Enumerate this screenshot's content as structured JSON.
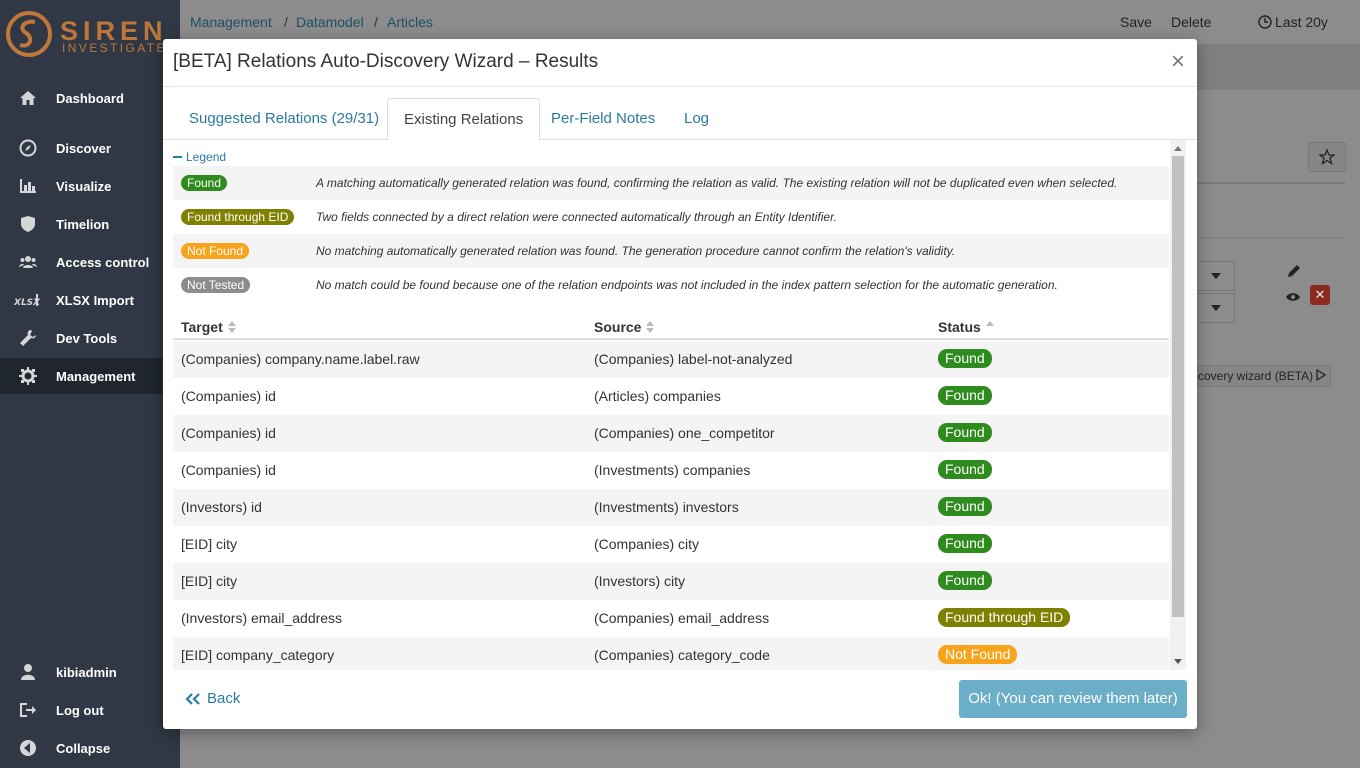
{
  "brand": {
    "name": "SIREN",
    "sub": "INVESTIGATE"
  },
  "sidebar": {
    "items": [
      {
        "label": "Dashboard",
        "icon": "home-icon"
      },
      {
        "label": "Discover",
        "icon": "compass-icon"
      },
      {
        "label": "Visualize",
        "icon": "bar-chart-icon"
      },
      {
        "label": "Timelion",
        "icon": "shield-icon"
      },
      {
        "label": "Access control",
        "icon": "users-icon"
      },
      {
        "label": "XLSX Import",
        "icon": "xlsx-icon"
      },
      {
        "label": "Dev Tools",
        "icon": "wrench-icon"
      },
      {
        "label": "Management",
        "icon": "gear-icon"
      }
    ],
    "bottom": [
      {
        "label": "kibiadmin",
        "icon": "user-icon"
      },
      {
        "label": "Log out",
        "icon": "logout-icon"
      },
      {
        "label": "Collapse",
        "icon": "collapse-icon"
      }
    ]
  },
  "breadcrumb": {
    "items": [
      "Management",
      "Datamodel",
      "Articles"
    ],
    "sep": "/"
  },
  "top_actions": {
    "save": "Save",
    "delete": "Delete",
    "time": "Last 20y"
  },
  "background": {
    "wizard_btn": "covery wizard (BETA)"
  },
  "modal": {
    "title": "[BETA] Relations Auto-Discovery Wizard – Results",
    "close": "×",
    "tabs": [
      "Suggested Relations (29/31)",
      "Existing Relations",
      "Per-Field Notes",
      "Log"
    ],
    "active_tab": "Existing Relations",
    "legend_toggle": "Legend",
    "legend": [
      {
        "badge": "Found",
        "color": "#2e8b1e",
        "desc": "A matching automatically generated relation was found, confirming the relation as valid. The existing relation will not be duplicated even when selected."
      },
      {
        "badge": "Found through EID",
        "color": "#7f7f00",
        "desc": "Two fields connected by a direct relation were connected automatically through an Entity Identifier."
      },
      {
        "badge": "Not Found",
        "color": "#f5a41c",
        "desc": "No matching automatically generated relation was found. The generation procedure cannot confirm the relation's validity."
      },
      {
        "badge": "Not Tested",
        "color": "#8c8c8c",
        "desc": "No match could be found because one of the relation endpoints was not included in the index pattern selection for the automatic generation."
      }
    ],
    "columns": {
      "target": "Target",
      "source": "Source",
      "status": "Status"
    },
    "rows": [
      {
        "target": "(Companies) company.name.label.raw",
        "source": "(Companies) label-not-analyzed",
        "status": "Found",
        "color": "#2e8b1e"
      },
      {
        "target": "(Companies) id",
        "source": "(Articles) companies",
        "status": "Found",
        "color": "#2e8b1e"
      },
      {
        "target": "(Companies) id",
        "source": "(Companies) one_competitor",
        "status": "Found",
        "color": "#2e8b1e"
      },
      {
        "target": "(Companies) id",
        "source": "(Investments) companies",
        "status": "Found",
        "color": "#2e8b1e"
      },
      {
        "target": "(Investors) id",
        "source": "(Investments) investors",
        "status": "Found",
        "color": "#2e8b1e"
      },
      {
        "target": "[EID] city",
        "source": "(Companies) city",
        "status": "Found",
        "color": "#2e8b1e"
      },
      {
        "target": "[EID] city",
        "source": "(Investors) city",
        "status": "Found",
        "color": "#2e8b1e"
      },
      {
        "target": "(Investors) email_address",
        "source": "(Companies) email_address",
        "status": "Found through EID",
        "color": "#7f7f00"
      },
      {
        "target": "[EID] company_category",
        "source": "(Companies) category_code",
        "status": "Not Found",
        "color": "#f5a41c"
      }
    ],
    "back_label": "Back",
    "ok_label": "Ok! (You can review them later)"
  }
}
